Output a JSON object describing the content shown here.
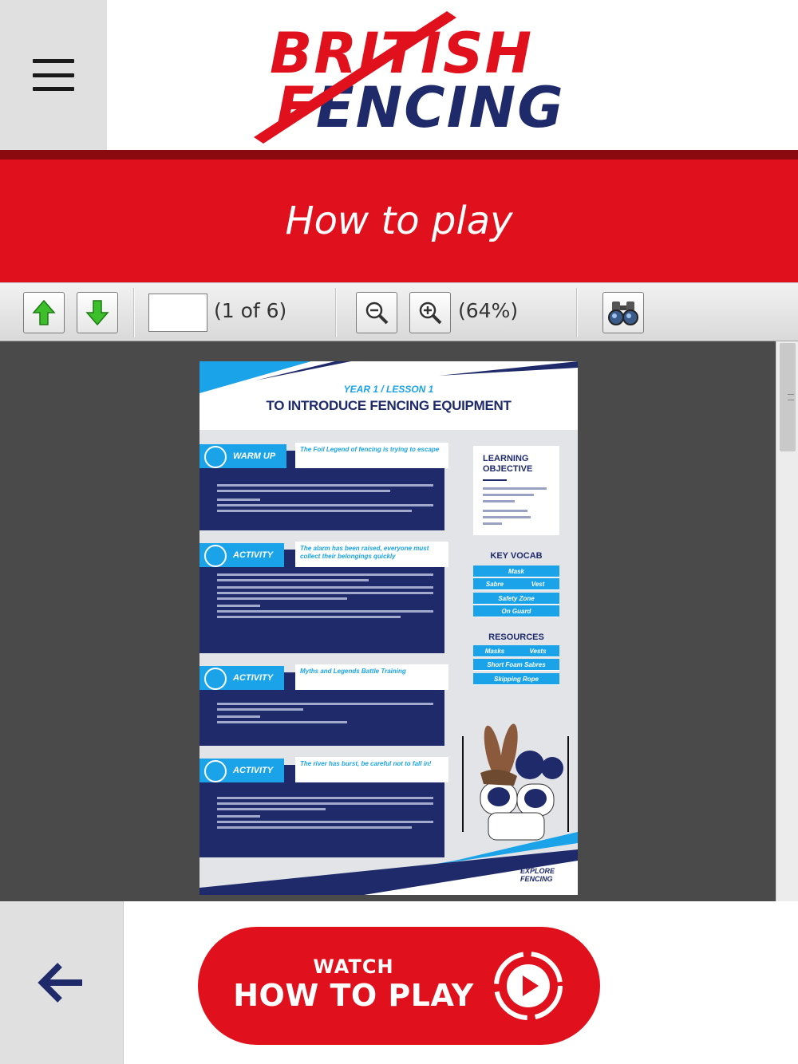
{
  "header": {
    "logo_line1": "BRITISH",
    "logo_line2_red": "F",
    "logo_line2_blue": "ENCING",
    "menu_icon": "hamburger-menu-icon"
  },
  "title": "How to play",
  "toolbar": {
    "page_input_value": "",
    "page_count": "(1 of 6)",
    "zoom_level": "(64%)",
    "icons": [
      "arrow-up-icon",
      "arrow-down-icon",
      "zoom-out-icon",
      "zoom-in-icon",
      "binoculars-icon"
    ]
  },
  "document": {
    "header_small": "YEAR 1 / LESSON 1",
    "header_title": "TO INTRODUCE FENCING EQUIPMENT",
    "sections": [
      {
        "tab": "WARM UP",
        "subtitle": "The Foil Legend of fencing is trying to escape"
      },
      {
        "tab": "ACTIVITY",
        "subtitle": "The alarm has been raised, everyone must collect their belongings quickly"
      },
      {
        "tab": "ACTIVITY",
        "subtitle": "Myths and Legends Battle Training"
      },
      {
        "tab": "ACTIVITY",
        "subtitle": "The river has burst, be careful not to fall in!"
      }
    ],
    "learning_objective_title": "LEARNING OBJECTIVE",
    "key_vocab_title": "KEY VOCAB",
    "key_vocab": [
      "Mask",
      "Sabre",
      "Vest",
      "Safety Zone",
      "On Guard"
    ],
    "resources_title": "RESOURCES",
    "resources": [
      "Masks",
      "Vests",
      "Short Foam Sabres",
      "Skipping Rope"
    ],
    "footer_logo_line1": "EXPLORE",
    "footer_logo_line2": "FENCING"
  },
  "bottom": {
    "back_icon": "arrow-left-icon",
    "watch_small": "WATCH",
    "watch_big": "HOW TO PLAY",
    "play_icon": "play-circle-icon"
  },
  "colors": {
    "brand_red": "#e0101c",
    "brand_navy": "#1f2a6b",
    "accent_blue": "#1aa3e8",
    "toolbar_gray": "#e0e0e0",
    "viewer_bg": "#4a4a4a"
  }
}
